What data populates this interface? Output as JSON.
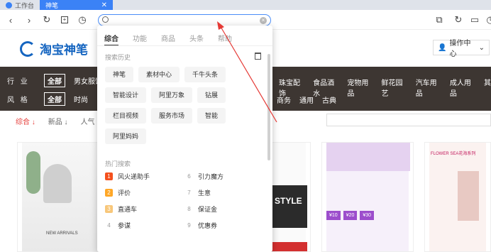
{
  "tabs": [
    {
      "label": "工作台",
      "active": false
    },
    {
      "label": "神笔",
      "active": true
    }
  ],
  "toolbar": {
    "back_icon": "chevron-left-icon",
    "forward_icon": "chevron-right-icon",
    "reload_icon": "reload-icon",
    "new_tab_icon": "new-tab-icon",
    "history_icon": "clock-icon",
    "address_value": "",
    "address_placeholder": ""
  },
  "brand": {
    "name": "淘宝神笔"
  },
  "operation_center": {
    "label": "操作中心"
  },
  "filter_band": {
    "row1_label": "行 业",
    "row1_all": "全部",
    "row1_items_left": [
      "男女服饰"
    ],
    "row1_items_right": [
      "珠宝配饰",
      "食品酒水",
      "宠物用品",
      "鲜花园艺",
      "汽车用品",
      "成人用品",
      "其"
    ],
    "row2_label": "风 格",
    "row2_all": "全部",
    "row2_items_left": [
      "时尚"
    ],
    "row2_items_right": [
      "商务",
      "通用",
      "古典"
    ]
  },
  "sort": {
    "items": [
      "综合 ↓",
      "新品 ↓",
      "人气"
    ],
    "active": 0
  },
  "dropdown": {
    "tabs": [
      "综合",
      "功能",
      "商品",
      "头条",
      "帮助"
    ],
    "active_tab": 0,
    "history_title": "搜索历史",
    "history": [
      "神笔",
      "素材中心",
      "千牛头条",
      "智能设计",
      "阿里万象",
      "钻展",
      "栏目视频",
      "服务市场",
      "智能",
      "阿里妈妈"
    ],
    "hot_title": "热门搜索",
    "hot": [
      {
        "rank": "1",
        "label": "风火递助手"
      },
      {
        "rank": "6",
        "label": "引力魔方"
      },
      {
        "rank": "2",
        "label": "评价"
      },
      {
        "rank": "7",
        "label": "生意"
      },
      {
        "rank": "3",
        "label": "直通车"
      },
      {
        "rank": "8",
        "label": "保证金"
      },
      {
        "rank": "4",
        "label": "参谋"
      },
      {
        "rank": "9",
        "label": "优惠券"
      }
    ]
  },
  "cards": {
    "card1_texts": [
      "NEW ARRIVALS"
    ],
    "card3_texts": [
      "STYLE"
    ],
    "card4_texts": [
      "¥10",
      "¥20",
      "¥30"
    ],
    "card5_texts": [
      "FLOWER SEA花海系列"
    ]
  },
  "colors": {
    "accent": "#3b82f6",
    "band": "#3d3632",
    "brand": "#1565c0",
    "arrow": "#e53935"
  }
}
